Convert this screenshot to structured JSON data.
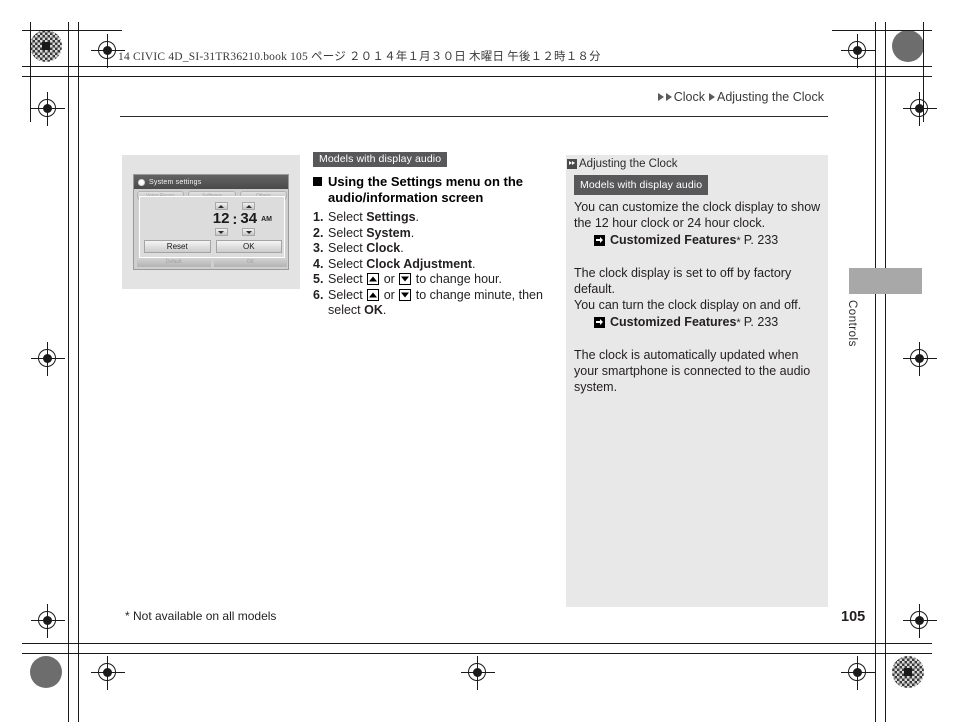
{
  "print_info": {
    "line": "14 CIVIC 4D_SI-31TR36210.book   105 ページ   ２０１４年１月３０日   木曜日   午後１２時１８分"
  },
  "breadcrumb": {
    "level1": "Clock",
    "level2": "Adjusting the Clock"
  },
  "screen_illustration": {
    "title": "System settings",
    "background_tabs": [
      "Voice Recog.",
      "Software",
      "Others"
    ],
    "background_footer": [
      "Default",
      "OK"
    ],
    "clock": {
      "hour": "12",
      "separator": ":",
      "minute": "34",
      "meridiem": "AM"
    },
    "buttons": {
      "reset": "Reset",
      "ok": "OK"
    }
  },
  "instructions": {
    "badge": "Models with display audio",
    "heading": "Using the Settings menu on the audio/information screen",
    "steps": [
      {
        "num": "1.",
        "pre": "Select ",
        "bold": "Settings",
        "post": "."
      },
      {
        "num": "2.",
        "pre": "Select ",
        "bold": "System",
        "post": "."
      },
      {
        "num": "3.",
        "pre": "Select ",
        "bold": "Clock",
        "post": "."
      },
      {
        "num": "4.",
        "pre": "Select ",
        "bold": "Clock Adjustment",
        "post": "."
      },
      {
        "num": "5.",
        "pre": "Select ",
        "mid": " or ",
        "post": " to change hour."
      },
      {
        "num": "6.",
        "pre": "Select ",
        "mid": " or ",
        "post": " to change minute, then select ",
        "bold": "OK",
        "tail": "."
      }
    ]
  },
  "info_panel": {
    "title": "Adjusting the Clock",
    "badge": "Models with display audio",
    "para1": "You can customize the clock display to show the 12 hour clock or 24 hour clock.",
    "ref1": {
      "name": "Customized Features",
      "star": "*",
      "page": "P. 233"
    },
    "para2_line1": "The clock display is set to off by factory default.",
    "para2_line2": "You can turn the clock display on and off.",
    "ref2": {
      "name": "Customized Features",
      "star": "*",
      "page": "P. 233"
    },
    "para3": "The clock is automatically updated when your smartphone is connected to the audio system."
  },
  "side_tab": {
    "label": "Controls"
  },
  "footer": {
    "footnote": "* Not available on all models",
    "page_number": "105"
  },
  "colors": {
    "badge_bg": "#58585a",
    "info_panel_bg": "#e8e8e8",
    "side_tab_bg": "#a8a8a8",
    "text": "#231f20"
  }
}
